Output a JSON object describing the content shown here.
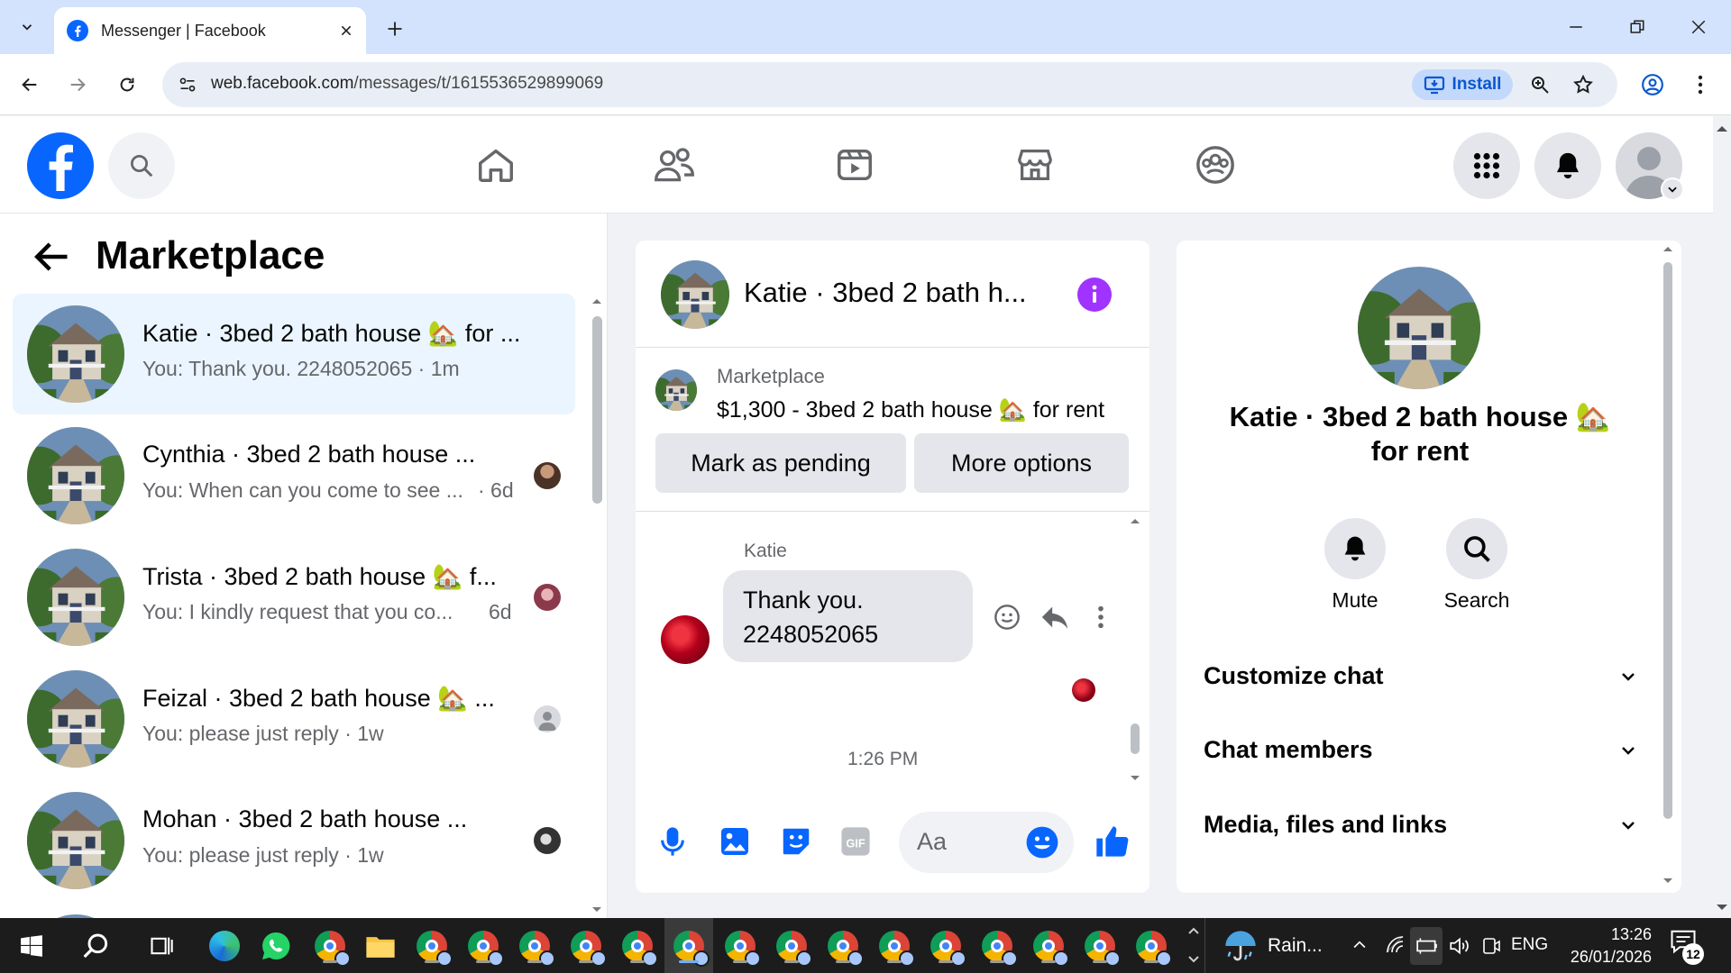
{
  "browser": {
    "tab_title": "Messenger | Facebook",
    "url_host": "web.facebook.com",
    "url_path": "/messages/t/1615536529899069",
    "install_label": "Install"
  },
  "left": {
    "title": "Marketplace",
    "conversations": [
      {
        "name": "Katie · 3bed 2 bath house 🏡 for ...",
        "preview": "You: Thank you. 2248052065",
        "time": "· 1m"
      },
      {
        "name": "Cynthia · 3bed 2 bath house ...",
        "preview": "You: When can you come to see ...",
        "time": "· 6d"
      },
      {
        "name": "Trista · 3bed 2 bath house 🏡 f...",
        "preview": "You: I kindly request that you co...",
        "time": "6d"
      },
      {
        "name": "Feizal · 3bed 2 bath house 🏡 ...",
        "preview": "You: please just reply",
        "time": "· 1w"
      },
      {
        "name": "Mohan · 3bed 2 bath house ...",
        "preview": "You: please just reply",
        "time": "· 1w"
      }
    ]
  },
  "chat": {
    "header_title": "Katie · 3bed 2 bath h...",
    "listing_label": "Marketplace",
    "listing_title": "$1,300 - 3bed 2 bath house 🏡 for rent",
    "mark_pending": "Mark as pending",
    "more_options": "More options",
    "sender": "Katie",
    "message_line1": "Thank you.",
    "message_line2": "2248052065",
    "timestamp": "1:26 PM",
    "input_placeholder": "Aa"
  },
  "info": {
    "name_line1": "Katie · 3bed 2 bath house 🏡",
    "name_line2": "for rent",
    "mute_label": "Mute",
    "search_label": "Search",
    "items": [
      "Customize chat",
      "Chat members",
      "Media, files and links"
    ]
  },
  "taskbar": {
    "weather": "Rain...",
    "lang": "ENG",
    "time": "13:26",
    "date": "26/01/2026",
    "notif_count": "12"
  },
  "colors": {
    "fb_blue": "#0866ff",
    "messenger_purple": "#a033ff",
    "active_bg": "#ebf5ff"
  }
}
